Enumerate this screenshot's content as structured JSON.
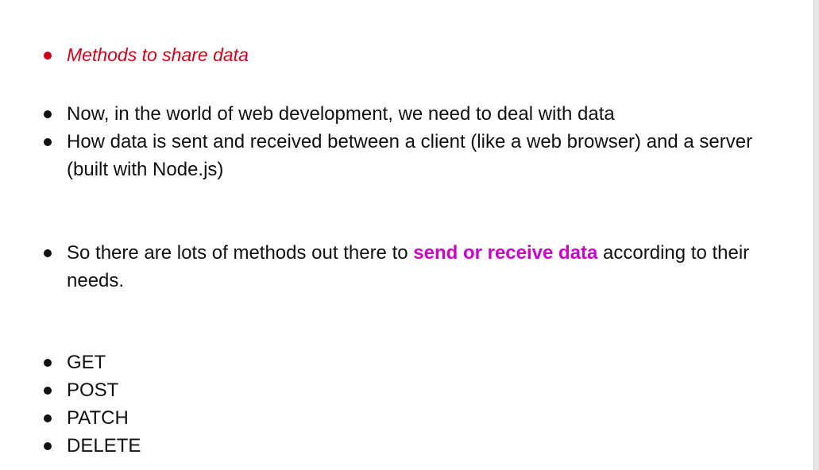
{
  "heading": {
    "text": "Methods to share data",
    "color": "#d0021b"
  },
  "points": [
    "Now, in the world of web development, we need to deal with data",
    "How data is sent and received between a client (like a web browser) and a server (built with Node.js)"
  ],
  "methods_point": {
    "before": "So there are lots of methods out there to ",
    "highlight": "send or receive data",
    "after": " according to their needs.",
    "highlight_color": "#cc00cc"
  },
  "http_methods": [
    "GET",
    "POST",
    "PATCH",
    "DELETE"
  ]
}
